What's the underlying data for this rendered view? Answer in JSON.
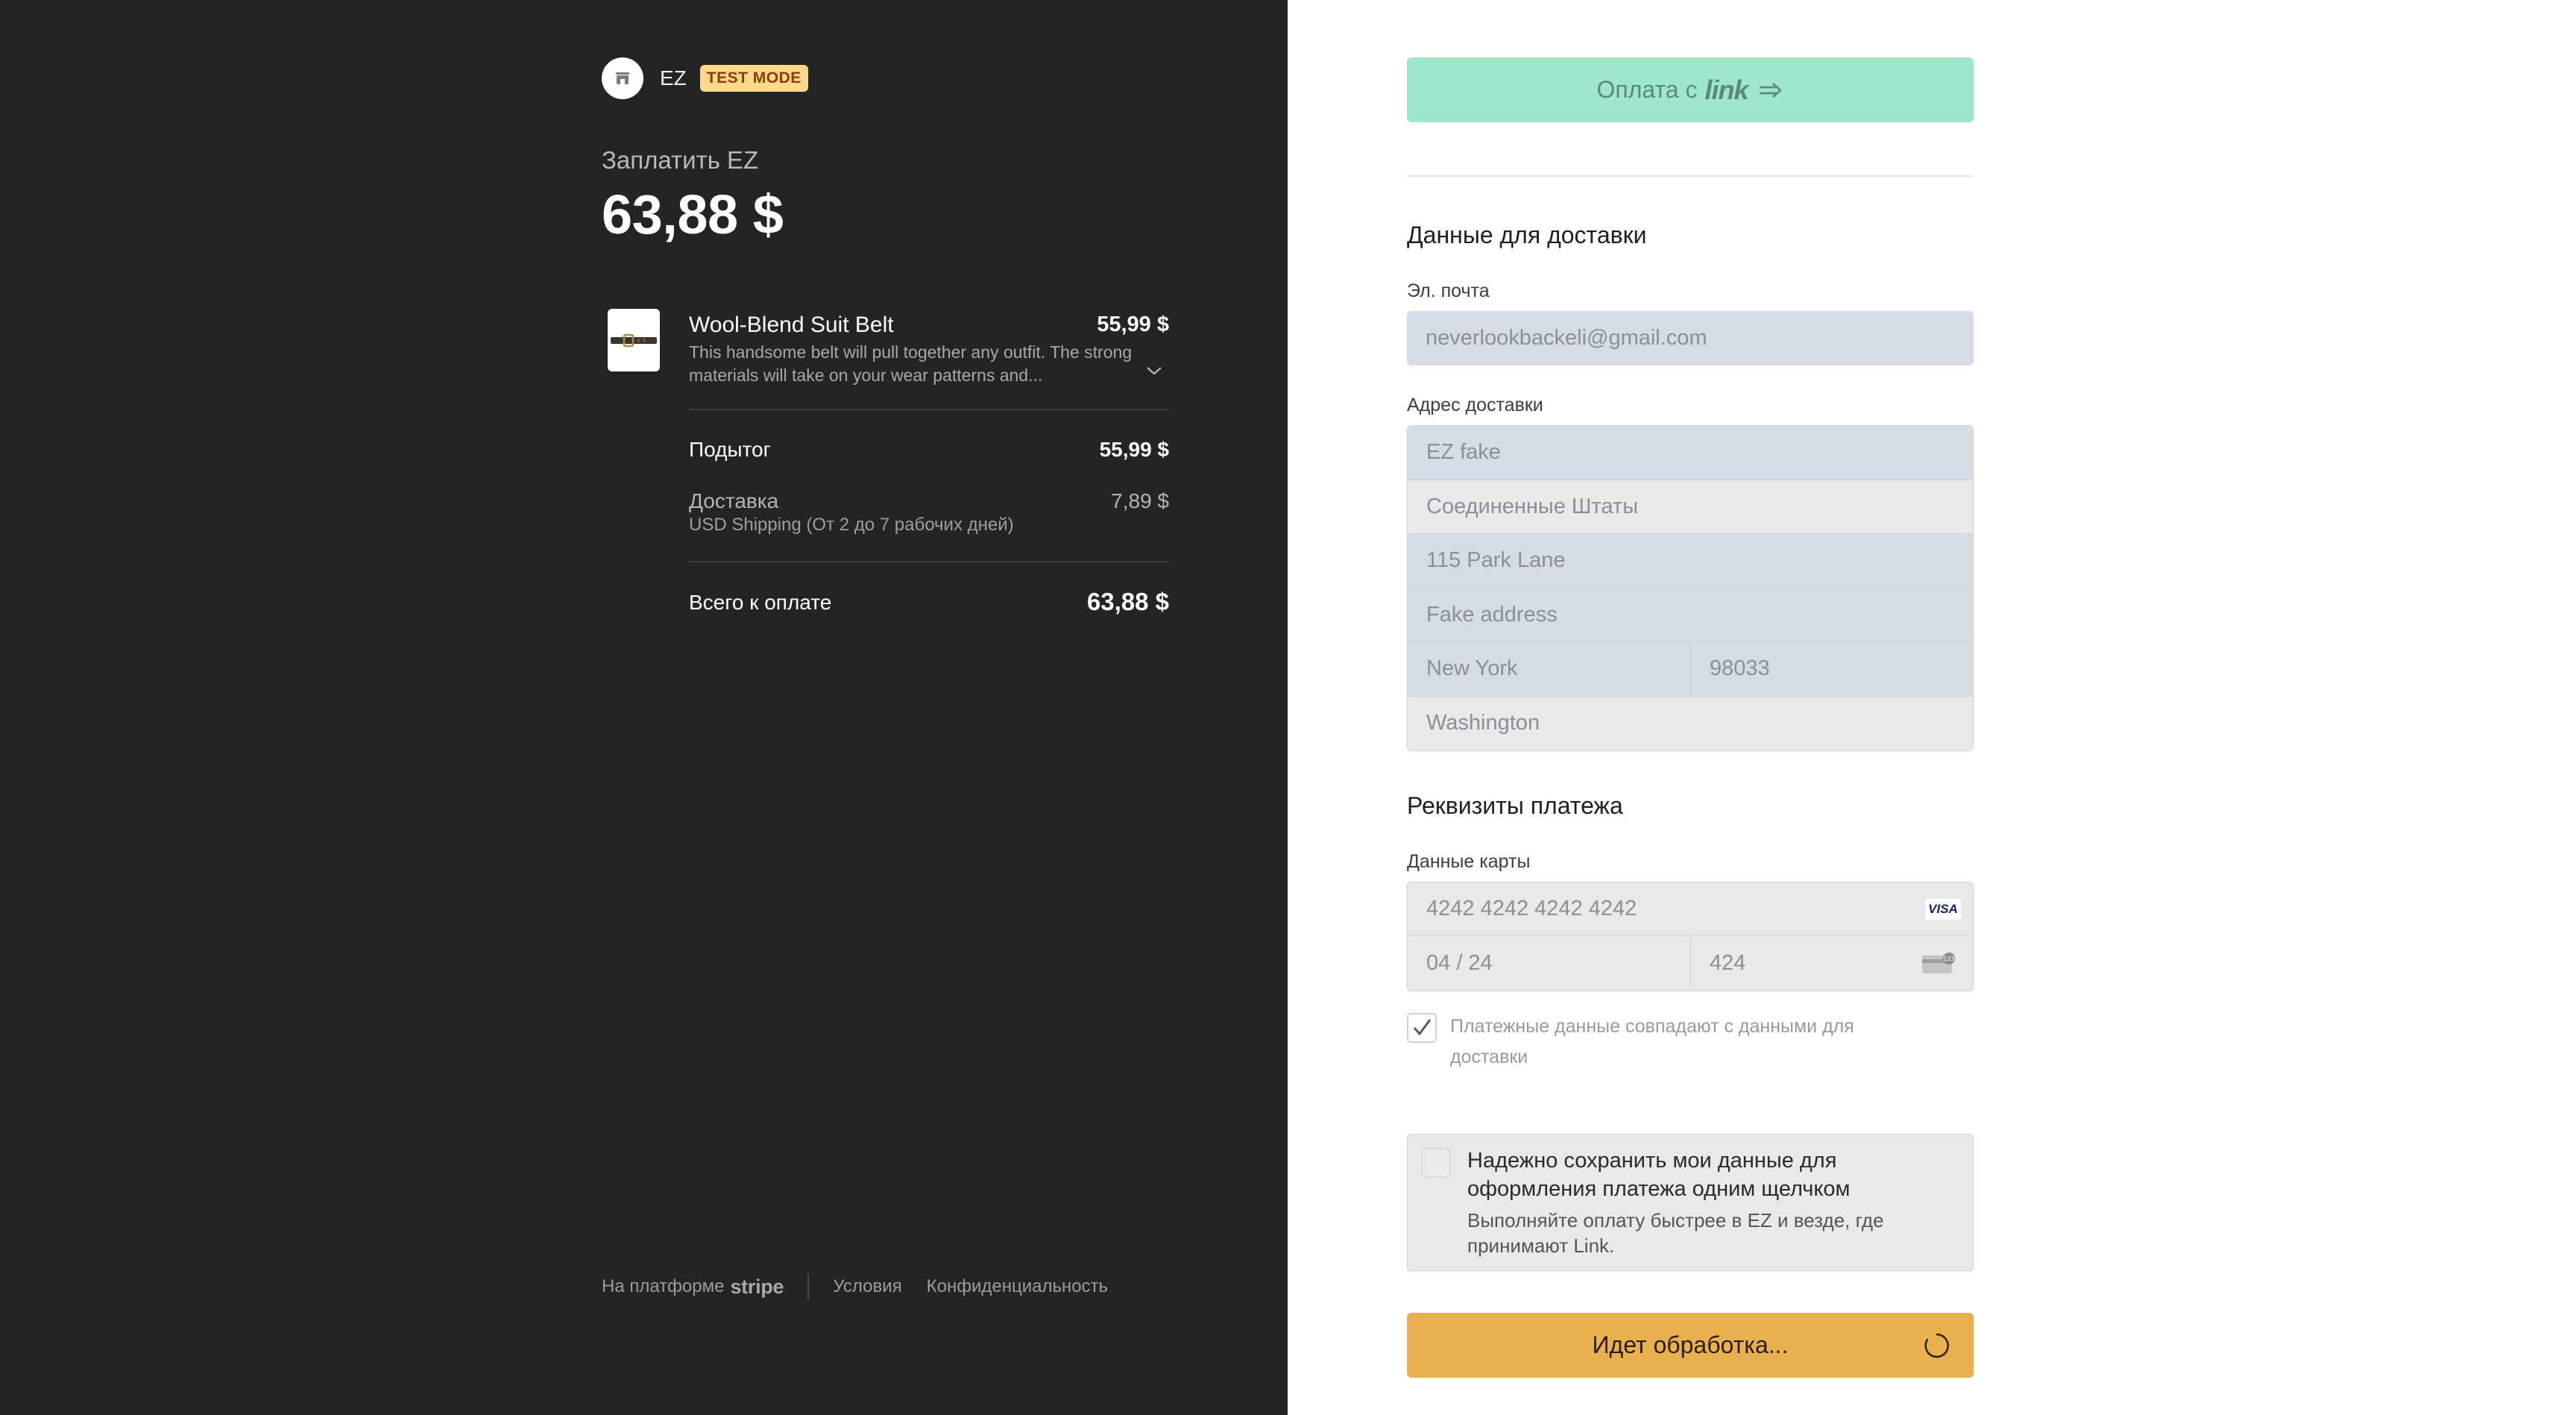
{
  "colors": {
    "left_bg": "#242424",
    "link_button": "#9ee8c9",
    "submit_button": "#e8b14e",
    "test_badge_bg": "#ffd88a",
    "input_bg_blue": "#d5dbe7",
    "input_bg_grey": "#e9e9e9"
  },
  "summary": {
    "merchant_name": "EZ",
    "test_badge": "TEST MODE",
    "pay_label": "Заплатить EZ",
    "total_amount": "63,88 $",
    "item": {
      "name": "Wool-Blend Suit Belt",
      "price": "55,99 $",
      "description": "This handsome belt will pull together any outfit. The strong materials will take on your wear patterns and...",
      "thumbnail_icon": "belt-image"
    },
    "subtotal_label": "Подытог",
    "subtotal_value": "55,99 $",
    "shipping_label": "Доставка",
    "shipping_value": "7,89 $",
    "shipping_detail": "USD Shipping (От 2 до 7 рабочих дней)",
    "total_label": "Всего к оплате",
    "total_value": "63,88 $"
  },
  "footer": {
    "powered_by": "На платформе",
    "stripe": "stripe",
    "terms": "Условия",
    "privacy": "Конфиденциальность"
  },
  "form": {
    "link_button_prefix": "Оплата с",
    "link_logo": "link",
    "shipping_title": "Данные для доставки",
    "email_label": "Эл. почта",
    "email_value": "neverlookbackeli@gmail.com",
    "address_label": "Адрес доставки",
    "address": {
      "name": "EZ fake",
      "country": "Соединенные Штаты",
      "line1": "115 Park Lane",
      "line2": "Fake address",
      "city": "New York",
      "zip": "98033",
      "state": "Washington"
    },
    "payment_title": "Реквизиты платежа",
    "card_label": "Данные карты",
    "card_number": "4242 4242 4242 4242",
    "card_brand": "VISA",
    "card_expiry": "04 / 24",
    "card_cvc": "424",
    "same_billing": "Платежные данные совпадают с данными для доставки",
    "same_billing_checked": true,
    "save_title": "Надежно сохранить мои данные для оформления платежа одним щелчком",
    "save_subtitle": "Выполняйте оплату быстрее в EZ и везде, где принимают Link.",
    "save_checked": false,
    "submit_label": "Идет обработка..."
  }
}
